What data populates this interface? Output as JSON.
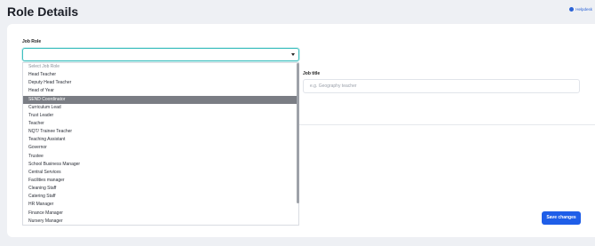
{
  "header": {
    "title": "Role Details",
    "helpdesk_label": "Helpdesk"
  },
  "form": {
    "job_role_label": "Job Role",
    "job_title_label": "Job title",
    "job_title_placeholder": "e.g. Geography teacher",
    "save_label": "Save changes"
  },
  "dropdown": {
    "selected_index": 4,
    "options": [
      "Select Job Role",
      "Head Teacher",
      "Deputy Head Teacher",
      "Head of Year",
      "SEND Coordinator",
      "Curriculum Lead",
      "Trust Leader",
      "Teacher",
      "NQT/ Trainee Teacher",
      "Teaching Assistant",
      "Governor",
      "Trustee",
      "School Business Manager",
      "Central Services",
      "Facilities manager",
      "Cleaning Staff",
      "Catering Staff",
      "HR Manager",
      "Finance Manager",
      "Nursery Manager"
    ]
  },
  "colors": {
    "accent": "#1f5ee8",
    "focus_border": "#3fbfbf",
    "selected_option": "#7a7d84"
  }
}
